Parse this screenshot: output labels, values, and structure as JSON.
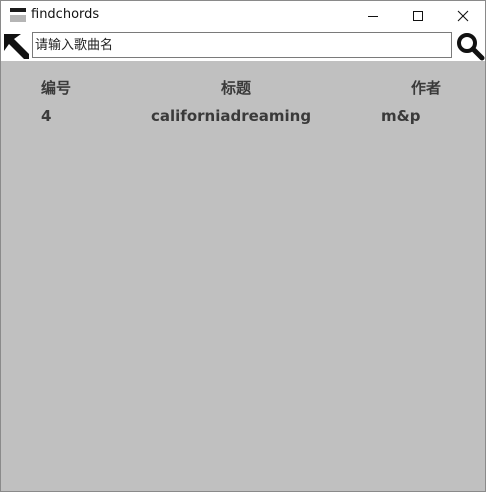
{
  "window": {
    "title": "findchords"
  },
  "search": {
    "placeholder": "请输入歌曲名",
    "value": ""
  },
  "table": {
    "headers": [
      "编号",
      "标题",
      "作者"
    ],
    "rows": [
      [
        "4",
        "californiadreaming",
        "m&p"
      ]
    ]
  },
  "icons": {
    "app": "app-icon",
    "left": "diagonal-arrow-icon",
    "search": "search-icon",
    "minimize": "minimize-icon",
    "maximize": "maximize-icon",
    "close": "close-icon"
  }
}
